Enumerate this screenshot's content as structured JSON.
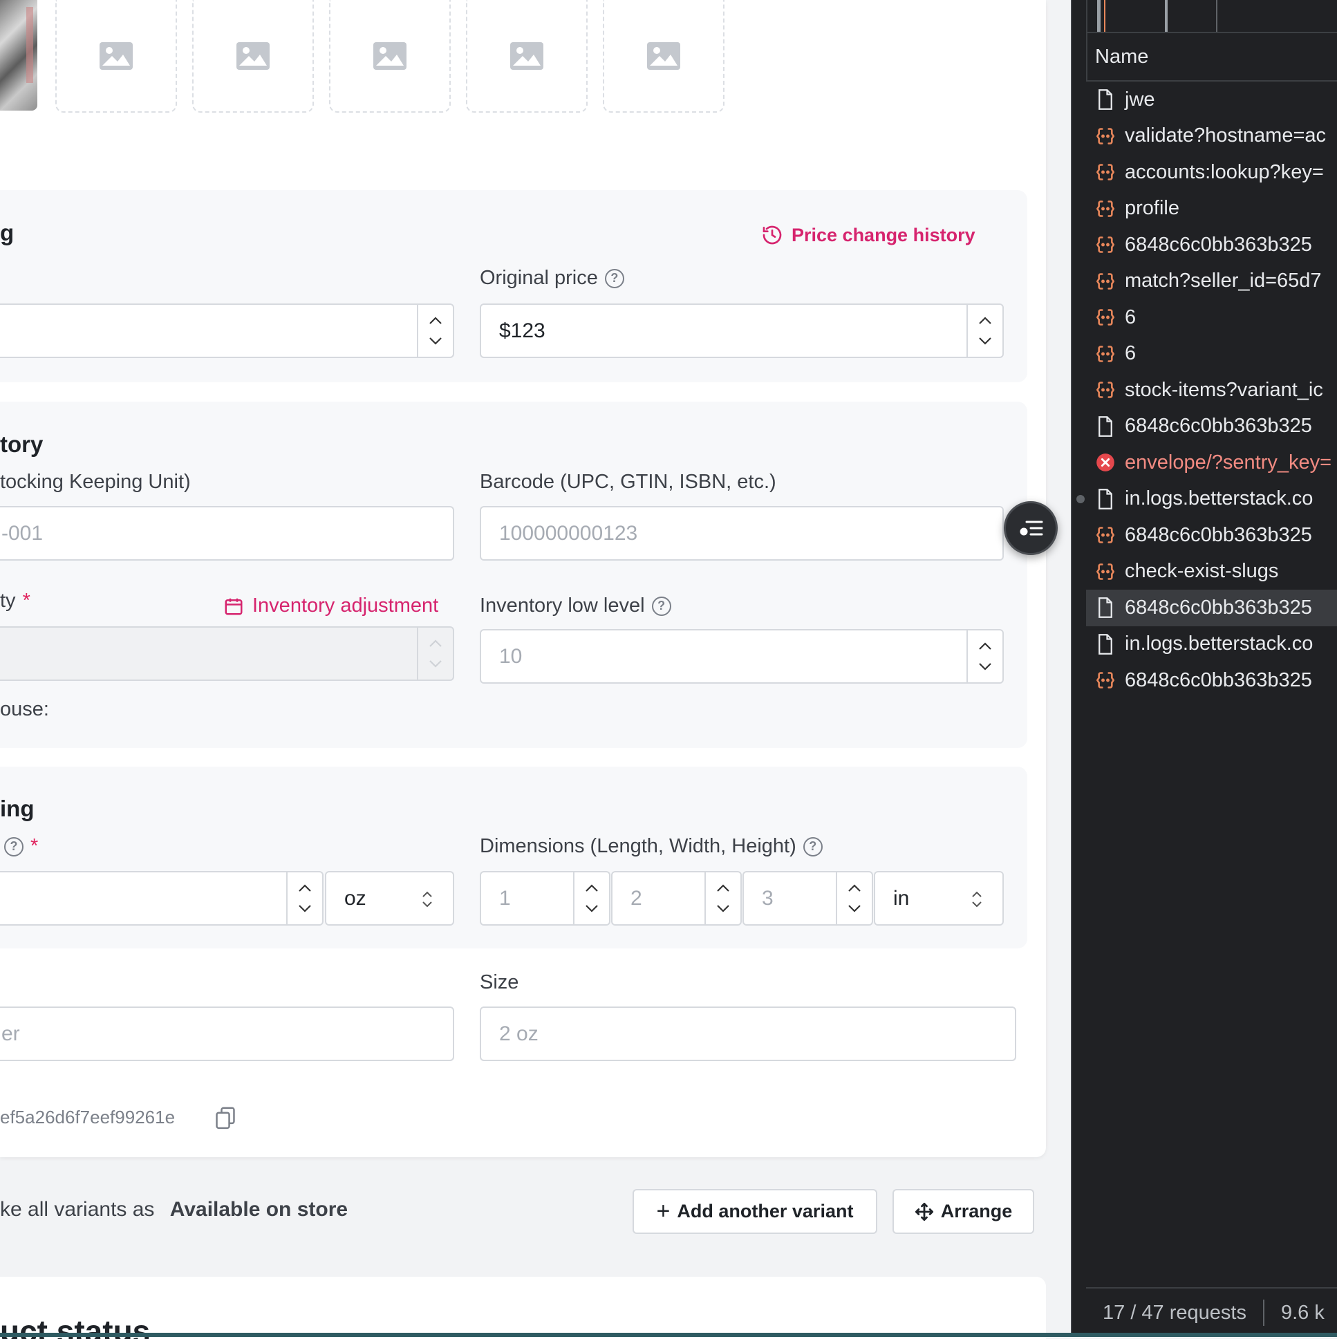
{
  "pricing": {
    "title": "g",
    "price_history_link": "Price change history",
    "original_price_label": "Original price",
    "original_price_value": "$123"
  },
  "inventory": {
    "title": "tory",
    "sku_label": "tocking Keeping Unit)",
    "sku_placeholder": "-001",
    "barcode_label": "Barcode (UPC, GTIN, ISBN, etc.)",
    "barcode_placeholder": "100000000123",
    "quantity_label": "ty",
    "inventory_adjustment_link": "Inventory adjustment",
    "low_level_label": "Inventory low level",
    "low_level_placeholder": "10",
    "warehouse_label": "ouse:"
  },
  "shipping": {
    "title": "ing",
    "weight_unit": "oz",
    "dimensions_label": "Dimensions (Length, Width, Height)",
    "length_placeholder": "1",
    "width_placeholder": "2",
    "height_placeholder": "3",
    "dimension_unit": "in"
  },
  "misc": {
    "left_placeholder": "er",
    "size_label": "Size",
    "size_placeholder": "2 oz",
    "variant_id": "ef5a26d6f7eef99261e"
  },
  "footer": {
    "mark_all_text": "ke all variants as",
    "available_text": "Available on store",
    "add_variant_label": "Add another variant",
    "arrange_label": "Arrange",
    "next_section_title": "uct status"
  },
  "devtools": {
    "column_header": "Name",
    "requests": [
      {
        "name": "jwe",
        "type": "doc"
      },
      {
        "name": "validate?hostname=ac",
        "type": "fetch"
      },
      {
        "name": "accounts:lookup?key=",
        "type": "fetch"
      },
      {
        "name": "profile",
        "type": "fetch"
      },
      {
        "name": "6848c6c0bb363b325",
        "type": "fetch"
      },
      {
        "name": "match?seller_id=65d7",
        "type": "fetch"
      },
      {
        "name": "6",
        "type": "fetch"
      },
      {
        "name": "6",
        "type": "fetch"
      },
      {
        "name": "stock-items?variant_ic",
        "type": "fetch"
      },
      {
        "name": "6848c6c0bb363b325",
        "type": "doc"
      },
      {
        "name": "envelope/?sentry_key=",
        "type": "error"
      },
      {
        "name": "in.logs.betterstack.co",
        "type": "doc"
      },
      {
        "name": "6848c6c0bb363b325",
        "type": "fetch"
      },
      {
        "name": "check-exist-slugs",
        "type": "fetch"
      },
      {
        "name": "6848c6c0bb363b325",
        "type": "doc",
        "selected": true
      },
      {
        "name": "in.logs.betterstack.co",
        "type": "doc"
      },
      {
        "name": "6848c6c0bb363b325",
        "type": "fetch"
      }
    ],
    "request_count": "17 / 47 requests",
    "transfer_size": "9.6 k"
  },
  "colors": {
    "accent_pink": "#d6246e",
    "required_red": "#e0245e",
    "devtools_bg": "#202124",
    "fetch_icon_orange": "#e8875b",
    "error_red": "#e5484d"
  }
}
